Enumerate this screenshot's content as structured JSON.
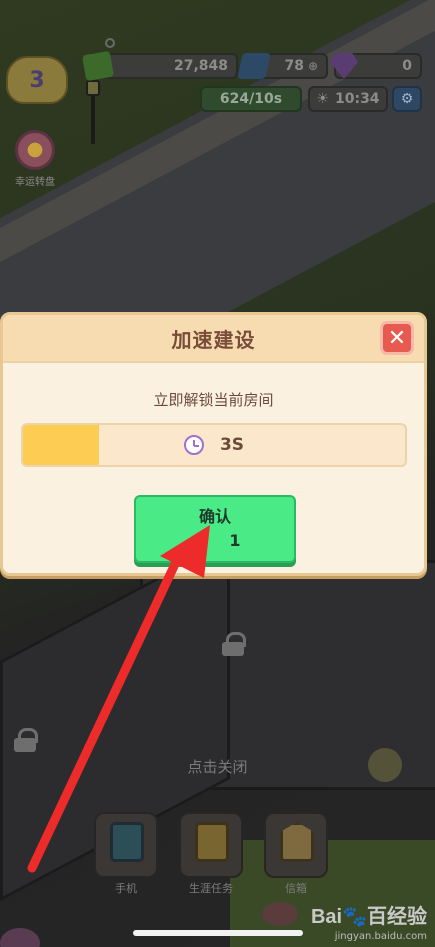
{
  "hud": {
    "level": "3",
    "money": "27,848",
    "energy": "78",
    "gems": "0",
    "income": "624/10s",
    "time": "10:34",
    "lucky_wheel_label": "幸运转盘"
  },
  "dialog": {
    "title": "加速建设",
    "close_symbol": "✕",
    "subtitle": "立即解锁当前房间",
    "progress_text": "3S",
    "progress_fraction": 0.2,
    "confirm_label": "确认",
    "confirm_cost": "1"
  },
  "tap_close_hint": "点击关闭",
  "dock": {
    "items": [
      {
        "label": "手机",
        "icon": "phone-icon"
      },
      {
        "label": "生涯任务",
        "icon": "task-icon"
      },
      {
        "label": "信箱",
        "icon": "mail-icon"
      }
    ]
  },
  "watermark": {
    "main": "Bai🐾百经验",
    "sub": "jingyan.baidu.com"
  },
  "colors": {
    "dialog_bg": "#fbf1e1",
    "confirm_green": "#4aea86",
    "close_red": "#e65a50",
    "progress_fill": "#fdcc52",
    "annotation_arrow": "#ee2b2b"
  }
}
